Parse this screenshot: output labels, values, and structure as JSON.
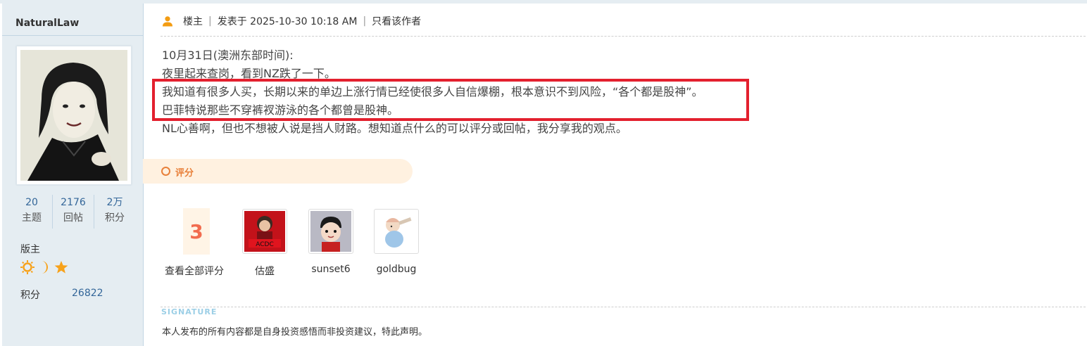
{
  "author": {
    "name": "NaturalLaw",
    "stats": [
      {
        "value": "20",
        "label": "主题"
      },
      {
        "value": "2176",
        "label": "回帖"
      },
      {
        "value": "2万",
        "label": "积分"
      }
    ],
    "role": "版主",
    "medal_icons": [
      "sun-icon",
      "moon-icon",
      "star-icon"
    ],
    "points_label": "积分",
    "points_value": "26822"
  },
  "post_header": {
    "floor_label": "楼主",
    "posted_at": "发表于 2025-10-30 10:18 AM",
    "author_only_link": "只看该作者"
  },
  "content": {
    "lines": [
      "10月31日(澳洲东部时间):",
      "夜里起来查岗，看到NZ跌了一下。",
      "我知道有很多人买，长期以来的单边上涨行情已经使很多人自信爆棚，根本意识不到风险，“各个都是股神”。",
      "巴菲特说那些不穿裤衩游泳的各个都曾是股神。",
      "NL心善啊，但也不想被人说是挡人财路。想知道点什么的可以评分或回帖，我分享我的观点。"
    ],
    "highlight_color": "#e3202e"
  },
  "rating": {
    "section_label": "评分",
    "total_count": "3",
    "view_all_label": "查看全部评分",
    "raters": [
      {
        "name": "估盛"
      },
      {
        "name": "sunset6"
      },
      {
        "name": "goldbug"
      }
    ]
  },
  "signature": {
    "label": "SIGNATURE",
    "text": "本人发布的所有内容都是自身投资感悟而非投资建议，特此声明。"
  },
  "colors": {
    "sidebar_bg": "#e5edf2",
    "accent_orange": "#e8803a",
    "score_red": "#f26c4f",
    "link_blue": "#336699"
  }
}
